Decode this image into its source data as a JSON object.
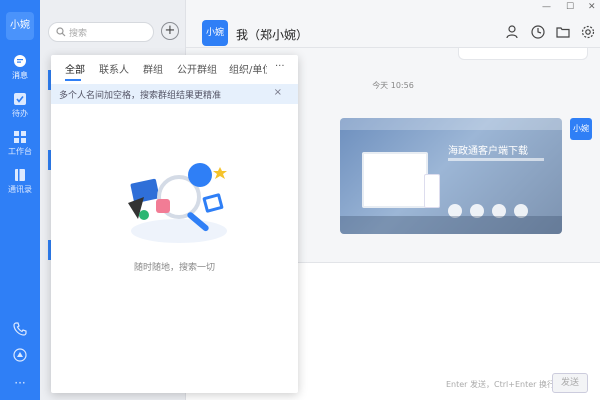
{
  "rail": {
    "avatar": "小婉",
    "items": [
      {
        "label": "消息",
        "icon": "chat-icon"
      },
      {
        "label": "待办",
        "icon": "checkbox-icon"
      },
      {
        "label": "工作台",
        "icon": "grid-icon"
      },
      {
        "label": "通讯录",
        "icon": "contacts-icon"
      }
    ],
    "bottom_icons": [
      "phone-icon",
      "cloud-icon",
      "more-icon"
    ],
    "more": "···"
  },
  "list": {
    "search_placeholder": "搜索",
    "add_label": "+"
  },
  "search_panel": {
    "tabs": [
      "全部",
      "联系人",
      "群组",
      "公开群组",
      "组织/单位",
      "···"
    ],
    "hint": "多个人名间加空格，搜索群组结果更精准",
    "hint_close": "×",
    "empty_text": "随时随地，搜索一切"
  },
  "chat": {
    "avatar": "小婉",
    "title": "我（郑小婉）",
    "header_icons": [
      "add-user-icon",
      "clock-icon",
      "folder-icon",
      "gear-icon"
    ],
    "window_controls": [
      "—",
      "☐",
      "✕"
    ],
    "timestamp": "今天 10:56",
    "message_avatar": "小婉",
    "card_title": "海政通客户端下载",
    "send_hint": "Enter 发送，Ctrl+Enter 换行",
    "send_label": "发送"
  },
  "colors": {
    "accent": "#2f7ff6"
  }
}
